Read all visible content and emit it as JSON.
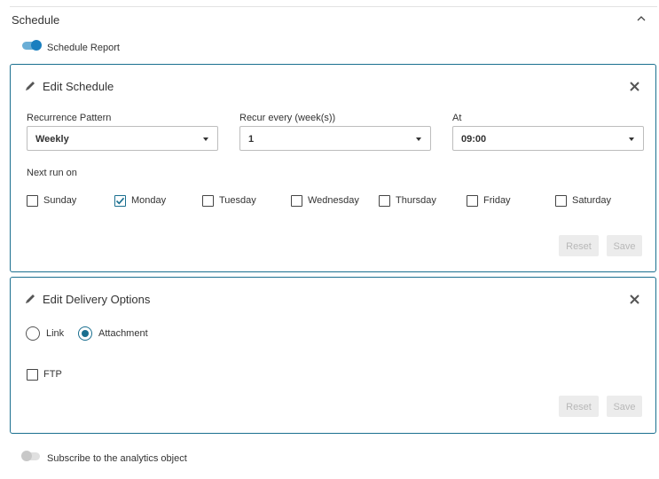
{
  "section": {
    "title": "Schedule"
  },
  "schedule_toggle": {
    "label": "Schedule Report",
    "on": true
  },
  "edit_schedule": {
    "title": "Edit Schedule",
    "recurrence": {
      "label": "Recurrence Pattern",
      "value": "Weekly"
    },
    "recur_every": {
      "label": "Recur every (week(s))",
      "value": "1"
    },
    "at": {
      "label": "At",
      "value": "09:00"
    },
    "next_run_label": "Next run on",
    "days": [
      {
        "label": "Sunday",
        "checked": false
      },
      {
        "label": "Monday",
        "checked": true
      },
      {
        "label": "Tuesday",
        "checked": false
      },
      {
        "label": "Wednesday",
        "checked": false
      },
      {
        "label": "Thursday",
        "checked": false
      },
      {
        "label": "Friday",
        "checked": false
      },
      {
        "label": "Saturday",
        "checked": false
      }
    ],
    "reset_label": "Reset",
    "save_label": "Save"
  },
  "edit_delivery": {
    "title": "Edit Delivery Options",
    "link_label": "Link",
    "attachment_label": "Attachment",
    "selected": "Attachment",
    "ftp_label": "FTP",
    "ftp_checked": false,
    "reset_label": "Reset",
    "save_label": "Save"
  },
  "subscribe_toggle": {
    "label": "Subscribe to the analytics object",
    "on": false
  },
  "colors": {
    "accent": "#1a6f8f",
    "toggle_on": "#1a7fbf",
    "disabled_btn": "#ececec"
  }
}
